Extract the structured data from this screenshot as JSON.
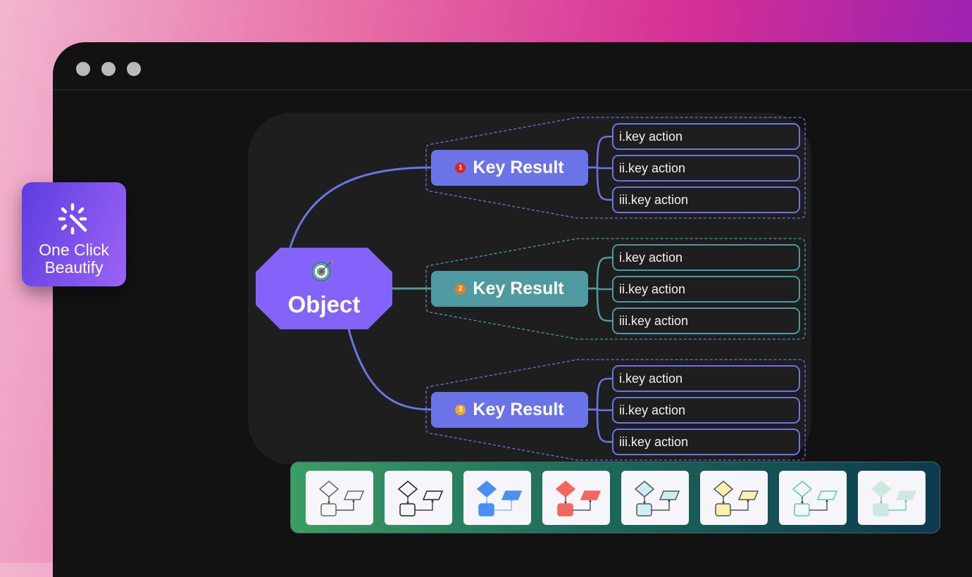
{
  "window": {
    "dots": 3
  },
  "beautify": {
    "line1": "One Click",
    "line2": "Beautify",
    "icon": "magic-wand-sparkle-icon"
  },
  "mindmap": {
    "root": {
      "label": "Object",
      "icon": "target-dart-icon",
      "color": "#8463fb"
    },
    "branches": [
      {
        "badge": "1",
        "badge_color": "#e0231b",
        "label": "Key Result",
        "color": "#6b74e6",
        "actions": [
          "i.key action",
          "ii.key action",
          "iii.key action"
        ]
      },
      {
        "badge": "2",
        "badge_color": "#f07a1a",
        "label": "Key Result",
        "color": "#4e9aa0",
        "actions": [
          "i.key action",
          "ii.key action",
          "iii.key action"
        ]
      },
      {
        "badge": "3",
        "badge_color": "#f5a623",
        "label": "Key Result",
        "color": "#6b74e6",
        "actions": [
          "i.key action",
          "ii.key action",
          "iii.key action"
        ]
      }
    ]
  },
  "palette": {
    "themes": [
      {
        "fill": "none",
        "stroke": "#666666",
        "line": "#333333"
      },
      {
        "fill": "none",
        "stroke": "#222222",
        "line": "#222222"
      },
      {
        "fill": "#4a8ff5",
        "stroke": "#4a8ff5",
        "line": "#7aaaf5"
      },
      {
        "fill": "#f2665e",
        "stroke": "#f2665e",
        "line": "#333333"
      },
      {
        "fill": "#cdeef5",
        "stroke": "#555555",
        "line": "#333333"
      },
      {
        "fill": "#fdefae",
        "stroke": "#555555",
        "line": "#333333"
      },
      {
        "fill": "#f3f8f6",
        "stroke": "#5cc9b0",
        "line": "#333333"
      },
      {
        "fill": "#cde8df",
        "stroke": "#cde8df",
        "line": "#4cc0a6"
      }
    ]
  }
}
